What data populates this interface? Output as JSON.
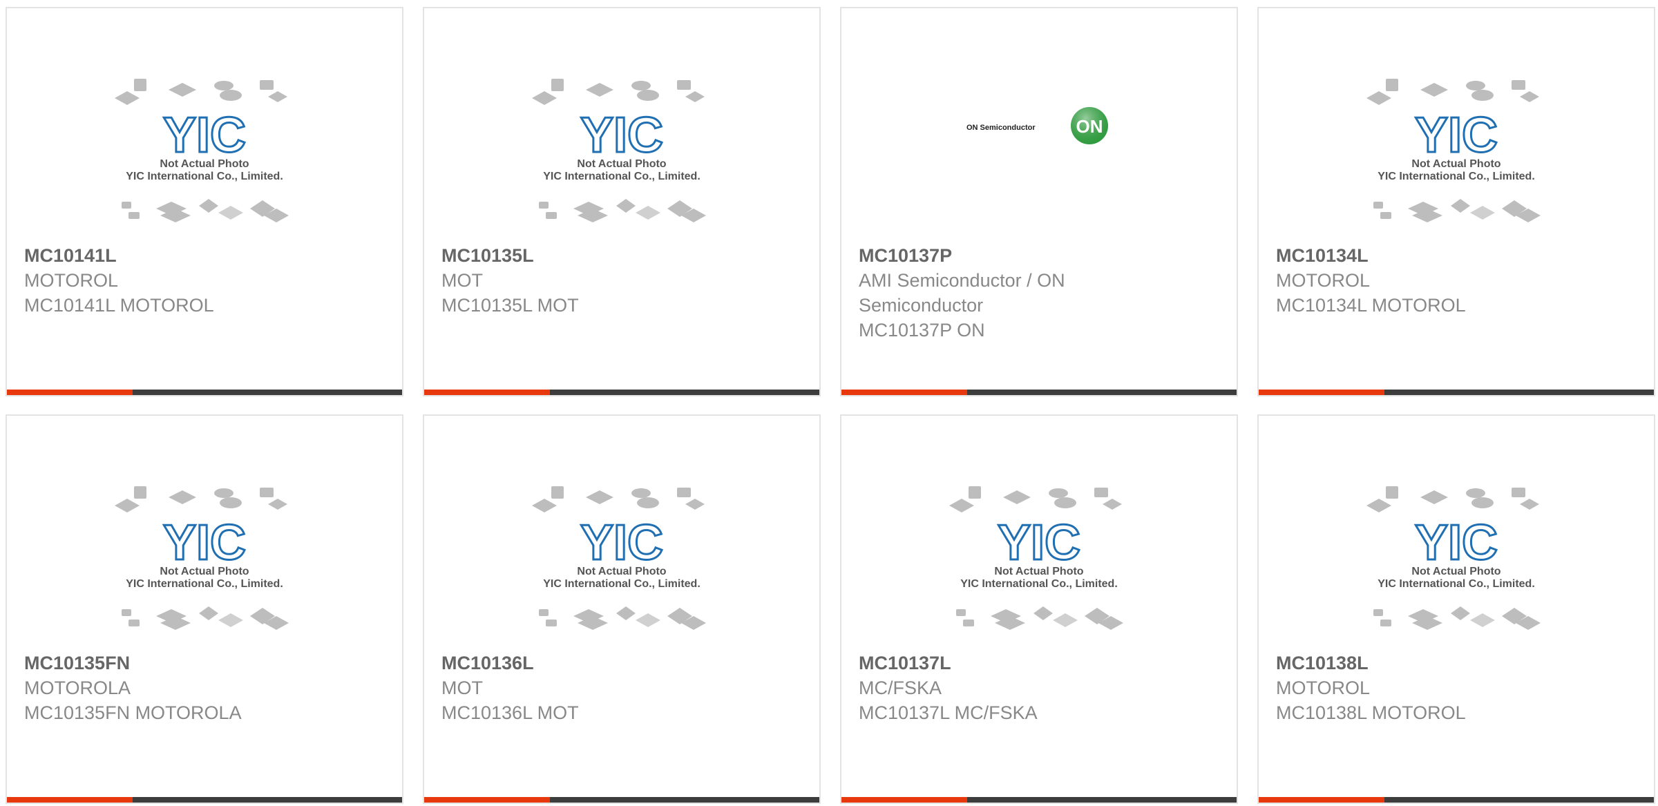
{
  "placeholder": {
    "line1": "Not Actual Photo",
    "line2": "YIC International Co., Limited.",
    "logo_text": "YIC"
  },
  "on_logo": {
    "wordmark": "ON Semiconductor",
    "badge": "ON"
  },
  "colors": {
    "accent": "#e8390e",
    "bar": "#3d3d3d",
    "logo_blue": "#1f6fb2"
  },
  "products": [
    {
      "part": "MC10141L",
      "maker": "MOTOROL",
      "desc": "MC10141L MOTOROL",
      "image": "yic-placeholder"
    },
    {
      "part": "MC10135L",
      "maker": "MOT",
      "desc": "MC10135L MOT",
      "image": "yic-placeholder"
    },
    {
      "part": "MC10137P",
      "maker": "AMI Semiconductor / ON Semiconductor",
      "desc": "MC10137P ON",
      "image": "on-semiconductor-logo"
    },
    {
      "part": "MC10134L",
      "maker": "MOTOROL",
      "desc": "MC10134L MOTOROL",
      "image": "yic-placeholder"
    },
    {
      "part": "MC10135FN",
      "maker": "MOTOROLA",
      "desc": "MC10135FN MOTOROLA",
      "image": "yic-placeholder"
    },
    {
      "part": "MC10136L",
      "maker": "MOT",
      "desc": "MC10136L MOT",
      "image": "yic-placeholder"
    },
    {
      "part": "MC10137L",
      "maker": "MC/FSKA",
      "desc": "MC10137L MC/FSKA",
      "image": "yic-placeholder"
    },
    {
      "part": "MC10138L",
      "maker": "MOTOROL",
      "desc": "MC10138L MOTOROL",
      "image": "yic-placeholder"
    }
  ]
}
